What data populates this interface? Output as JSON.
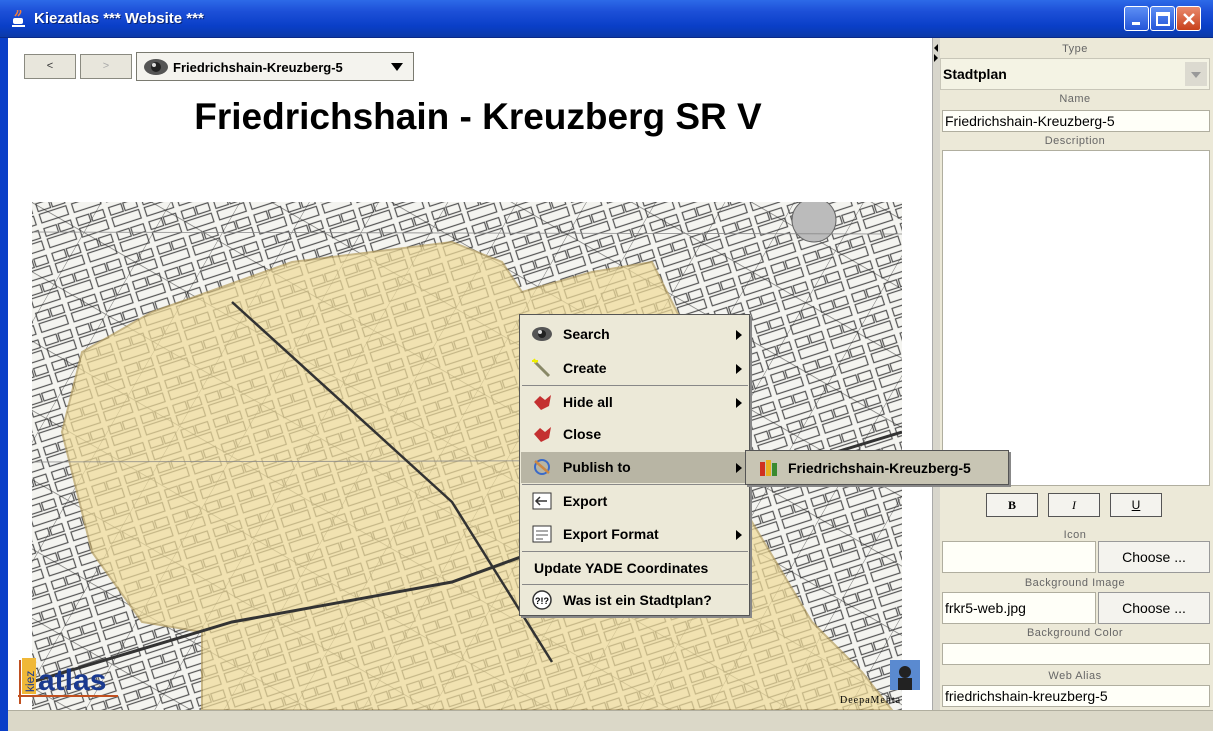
{
  "window": {
    "title": "Kiezatlas *** Website ***",
    "minimize_icon": "minimize-icon",
    "maximize_icon": "maximize-icon",
    "close_icon": "close-icon"
  },
  "nav": {
    "back_label": "<",
    "forward_label": ">",
    "topic_selected": "Friedrichshain-Kreuzberg-5"
  },
  "page": {
    "title": "Friedrichshain - Kreuzberg SR V",
    "logo_text": "atlas",
    "logo_side_text": "kiez",
    "deepamehta_text": "DeepaMehta"
  },
  "context_menu": {
    "items": [
      {
        "label": "Search",
        "icon": "eye-icon",
        "submenu": true
      },
      {
        "label": "Create",
        "icon": "magic-wand-icon",
        "submenu": true
      },
      {
        "label": "Hide all",
        "icon": "hide-icon",
        "submenu": true
      },
      {
        "label": "Close",
        "icon": "close-topic-icon",
        "submenu": false
      },
      {
        "label": "Publish to",
        "icon": "publish-icon",
        "submenu": true
      },
      {
        "label": "Export",
        "icon": "export-icon",
        "submenu": false
      },
      {
        "label": "Export Format",
        "icon": "export-format-icon",
        "submenu": true
      },
      {
        "label": "Update YADE Coordinates",
        "icon": "",
        "submenu": false
      },
      {
        "label": "Was ist ein Stadtplan?",
        "icon": "help-icon",
        "submenu": false
      }
    ],
    "submenu_item": "Friedrichshain-Kreuzberg-5"
  },
  "properties": {
    "type_label": "Type",
    "type_value": "Stadtplan",
    "name_label": "Name",
    "name_value": "Friedrichshain-Kreuzberg-5",
    "description_label": "Description",
    "description_value": "",
    "bold_label": "B",
    "italic_label": "I",
    "underline_label": "U",
    "icon_label": "Icon",
    "icon_value": "",
    "choose_label": "Choose ...",
    "bg_image_label": "Background Image",
    "bg_image_value": "frkr5-web.jpg",
    "bg_color_label": "Background Color",
    "bg_color_value": "",
    "web_alias_label": "Web Alias",
    "web_alias_value": "friedrichshain-kreuzberg-5"
  },
  "colors": {
    "titlebar": "#0a3fc8",
    "map_highlight": "#f0dc9a",
    "menu_bg": "#ece9d8",
    "menu_active": "#b8b5a4"
  }
}
